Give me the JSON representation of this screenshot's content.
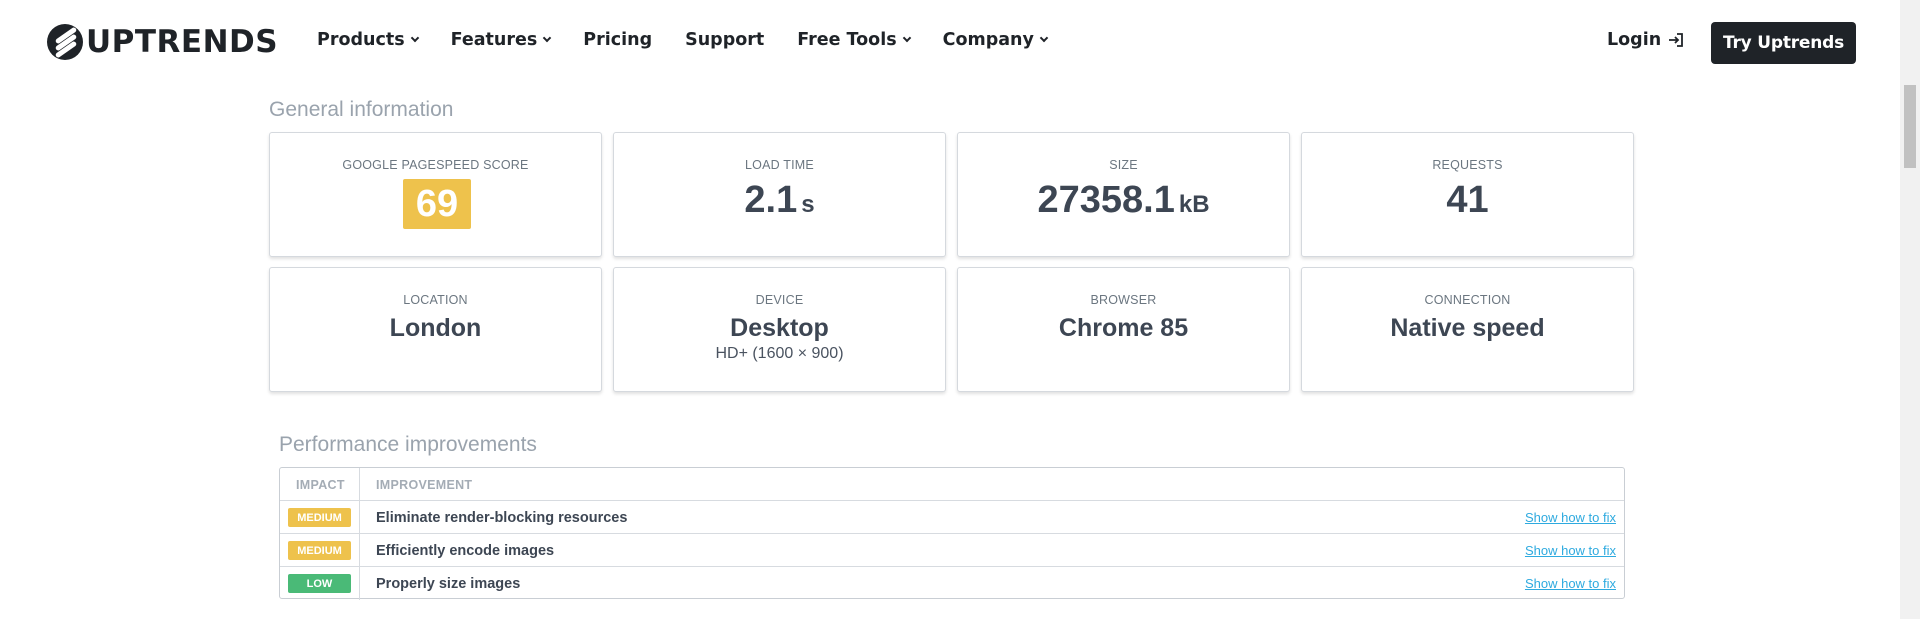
{
  "header": {
    "logo_text": "UPTRENDS",
    "nav": [
      {
        "label": "Products",
        "dropdown": true
      },
      {
        "label": "Features",
        "dropdown": true
      },
      {
        "label": "Pricing",
        "dropdown": false
      },
      {
        "label": "Support",
        "dropdown": false
      },
      {
        "label": "Free Tools",
        "dropdown": true
      },
      {
        "label": "Company",
        "dropdown": true
      }
    ],
    "login_label": "Login",
    "cta_label": "Try Uptrends"
  },
  "general_info": {
    "title": "General information",
    "cards": {
      "pagespeed": {
        "label": "GOOGLE PAGESPEED SCORE",
        "value": "69",
        "color": "#eec24c"
      },
      "load_time": {
        "label": "LOAD TIME",
        "value": "2.1",
        "unit": "s"
      },
      "size": {
        "label": "SIZE",
        "value": "27358.1",
        "unit": "kB"
      },
      "requests": {
        "label": "REQUESTS",
        "value": "41"
      },
      "location": {
        "label": "LOCATION",
        "value": "London"
      },
      "device": {
        "label": "DEVICE",
        "value": "Desktop",
        "sub": "HD+ (1600 × 900)"
      },
      "browser": {
        "label": "BROWSER",
        "value": "Chrome 85"
      },
      "connection": {
        "label": "CONNECTION",
        "value": "Native speed"
      }
    }
  },
  "performance": {
    "title": "Performance improvements",
    "columns": [
      "IMPACT",
      "IMPROVEMENT"
    ],
    "rows": [
      {
        "impact": "MEDIUM",
        "improvement": "Eliminate render-blocking resources",
        "link": "Show how to fix"
      },
      {
        "impact": "MEDIUM",
        "improvement": "Efficiently encode images",
        "link": "Show how to fix"
      },
      {
        "impact": "LOW",
        "improvement": "Properly size images",
        "link": "Show how to fix"
      }
    ],
    "colors": {
      "medium": "#eec24c",
      "low": "#4aba77",
      "link": "#2eaadf"
    }
  }
}
